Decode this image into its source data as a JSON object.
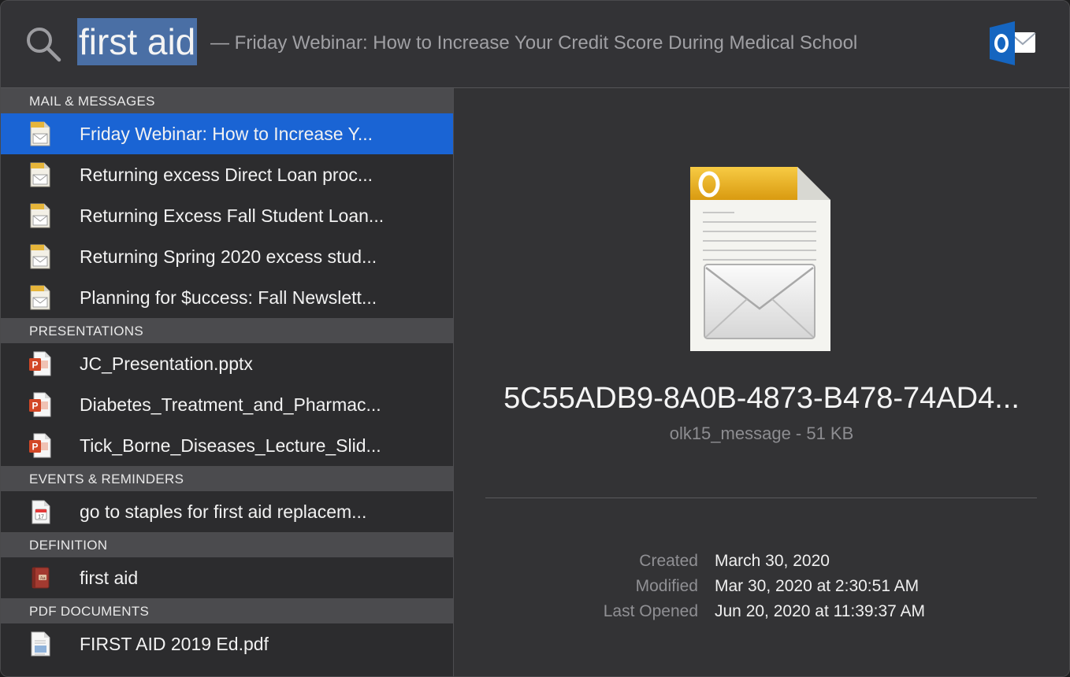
{
  "search": {
    "query": "first aid",
    "completion": "— Friday Webinar: How to Increase Your Credit Score During Medical School",
    "app_icon": "outlook-icon"
  },
  "sections": [
    {
      "title": "MAIL & MESSAGES",
      "icon": "mail-document-icon",
      "items": [
        "Friday Webinar: How to Increase Y...",
        "Returning excess Direct Loan proc...",
        "Returning Excess Fall Student Loan...",
        "Returning Spring 2020 excess stud...",
        "Planning for $uccess: Fall Newslett..."
      ]
    },
    {
      "title": "PRESENTATIONS",
      "icon": "powerpoint-icon",
      "items": [
        "JC_Presentation.pptx",
        "Diabetes_Treatment_and_Pharmac...",
        "Tick_Borne_Diseases_Lecture_Slid..."
      ]
    },
    {
      "title": "EVENTS & REMINDERS",
      "icon": "calendar-icon",
      "items": [
        "go to staples for first aid replacem..."
      ]
    },
    {
      "title": "DEFINITION",
      "icon": "dictionary-icon",
      "items": [
        "first aid"
      ]
    },
    {
      "title": "PDF DOCUMENTS",
      "icon": "pdf-icon",
      "items": [
        "FIRST AID 2019 Ed.pdf"
      ]
    }
  ],
  "selected": "Friday Webinar: How to Increase Y...",
  "preview": {
    "title": "5C55ADB9-8A0B-4873-B478-74AD4...",
    "subtitle": "olk15_message - 51 KB",
    "icon": "outlook-message-file-icon",
    "meta": [
      {
        "label": "Created",
        "value": "March 30, 2020"
      },
      {
        "label": "Modified",
        "value": "Mar 30, 2020 at 2:30:51 AM"
      },
      {
        "label": "Last Opened",
        "value": "Jun 20, 2020 at 11:39:37 AM"
      }
    ]
  },
  "colors": {
    "selection": "#1a64d4",
    "section_header": "#4b4b4e",
    "background": "#323234",
    "outlook_blue": "#1565c0"
  }
}
